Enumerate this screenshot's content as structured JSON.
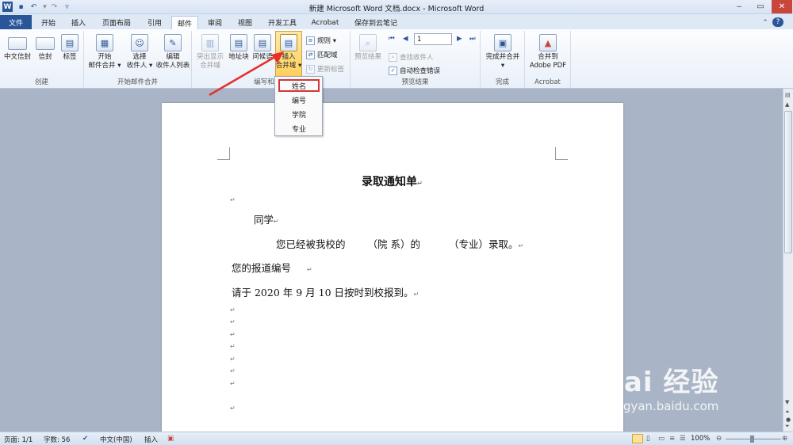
{
  "window": {
    "title": "新建 Microsoft Word 文档.docx - Microsoft Word"
  },
  "tabs": [
    "文件",
    "开始",
    "插入",
    "页面布局",
    "引用",
    "邮件",
    "审阅",
    "视图",
    "开发工具",
    "Acrobat",
    "保存到云笔记"
  ],
  "ribbon": {
    "groups": {
      "create": {
        "label": "创建",
        "buttons": [
          "中文信封",
          "信封",
          "标签"
        ]
      },
      "start": {
        "label": "开始邮件合并",
        "buttons": [
          "开始\n邮件合并 ▾",
          "选择\n收件人 ▾",
          "编辑\n收件人列表"
        ]
      },
      "write": {
        "label": "编写和插入",
        "buttons": [
          "突出显示\n合并域",
          "地址块",
          "问候语",
          "插入\n合并域 ▾"
        ],
        "small": [
          "规则 ▾",
          "匹配域",
          "更新标签"
        ]
      },
      "preview": {
        "label": "预览结果",
        "preview_btn": "预览结果",
        "record": "1",
        "small": [
          "查找收件人",
          "自动检查错误"
        ]
      },
      "finish": {
        "label": "完成",
        "button": "完成并合并\n▾"
      },
      "acrobat": {
        "label": "Acrobat",
        "button": "合并到\nAdobe PDF"
      }
    }
  },
  "merge_field_menu": [
    "姓名",
    "编号",
    "学院",
    "专业"
  ],
  "document": {
    "title": "录取通知单",
    "line1": "同学",
    "line2_a": "您已经被我校的",
    "line2_b": "（院 系）的",
    "line2_c": "（专业）录取。",
    "line3": "您的报道编号",
    "line4": "请于 2020 年 9 月 10 日按时到校报到。",
    "para_mark": "↵"
  },
  "statusbar": {
    "page": "页面: 1/1",
    "words": "字数: 56",
    "lang": "中文(中国)",
    "mode": "插入",
    "zoom": "100%"
  },
  "watermark": {
    "brand": "Bai  经验",
    "url": "jingyan.baidu.com"
  },
  "colors": {
    "file_tab": "#2a5699",
    "highlight": "#d6343a",
    "arrow": "#e53030"
  }
}
